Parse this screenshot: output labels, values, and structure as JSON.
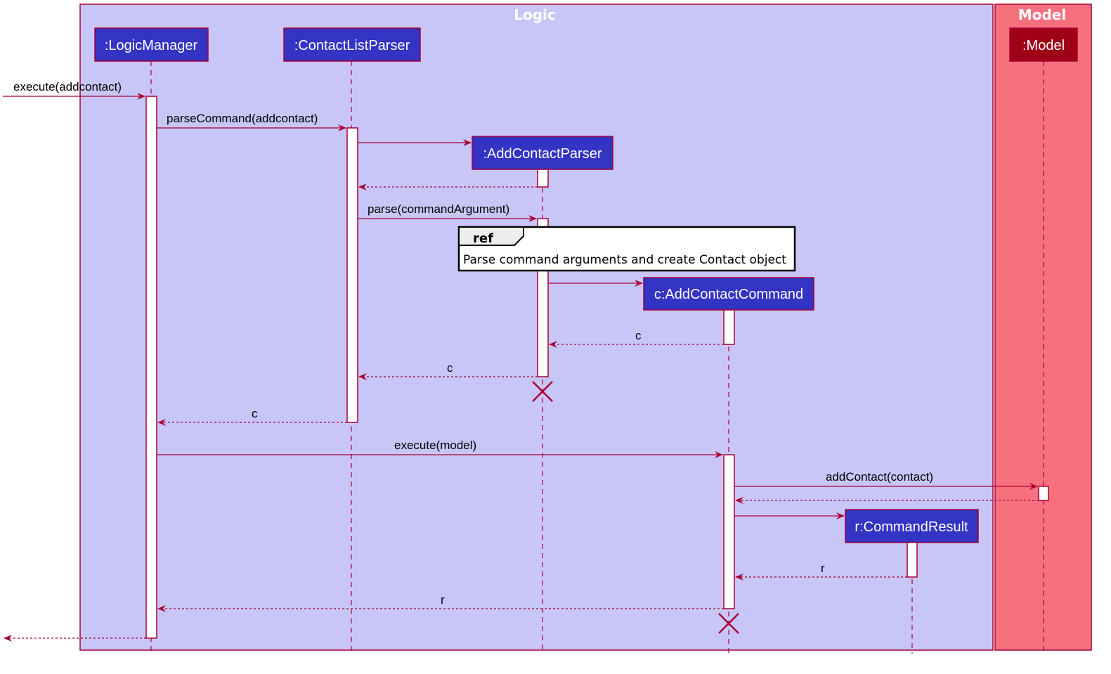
{
  "colors": {
    "logic_bg": "#C8C6F7",
    "model_bg": "#F7707E",
    "border": "#A80036",
    "participant_fill": "#3333C4",
    "model_participant_fill": "#A00016",
    "activation_fill": "#FFFFFF",
    "arrow": "#A80036",
    "ref_header": "#EEEEEE",
    "ref_border": "#000000"
  },
  "groups": [
    {
      "id": "logic",
      "title": "Logic"
    },
    {
      "id": "model",
      "title": "Model"
    }
  ],
  "participants": [
    {
      "id": "lm",
      "label": ":LogicManager",
      "group": "logic"
    },
    {
      "id": "clp",
      "label": ":ContactListParser",
      "group": "logic"
    },
    {
      "id": "acp",
      "label": ":AddContactParser",
      "group": "logic"
    },
    {
      "id": "acc",
      "label": "c:AddContactCommand",
      "group": "logic"
    },
    {
      "id": "cr",
      "label": "r:CommandResult",
      "group": "logic"
    },
    {
      "id": "model",
      "label": ":Model",
      "group": "model"
    }
  ],
  "messages": [
    {
      "from": "external",
      "to": "lm",
      "label": "execute(addcontact)",
      "type": "sync"
    },
    {
      "from": "lm",
      "to": "clp",
      "label": "parseCommand(addcontact)",
      "type": "sync"
    },
    {
      "from": "clp",
      "to": "acp",
      "label": "",
      "type": "create"
    },
    {
      "from": "acp",
      "to": "clp",
      "label": "",
      "type": "return"
    },
    {
      "from": "clp",
      "to": "acp",
      "label": "parse(commandArgument)",
      "type": "sync"
    },
    {
      "from": "acp",
      "to": "acc",
      "label": "",
      "type": "create"
    },
    {
      "from": "acc",
      "to": "acp",
      "label": "c",
      "type": "return"
    },
    {
      "from": "acp",
      "to": "clp",
      "label": "c",
      "type": "return"
    },
    {
      "from": "clp",
      "to": "lm",
      "label": "c",
      "type": "return"
    },
    {
      "from": "lm",
      "to": "acc",
      "label": "execute(model)",
      "type": "sync"
    },
    {
      "from": "acc",
      "to": "model",
      "label": "addContact(contact)",
      "type": "sync"
    },
    {
      "from": "model",
      "to": "acc",
      "label": "",
      "type": "return"
    },
    {
      "from": "acc",
      "to": "cr",
      "label": "",
      "type": "create"
    },
    {
      "from": "cr",
      "to": "acc",
      "label": "r",
      "type": "return"
    },
    {
      "from": "acc",
      "to": "lm",
      "label": "r",
      "type": "return"
    },
    {
      "from": "lm",
      "to": "external",
      "label": "",
      "type": "return"
    }
  ],
  "ref": {
    "tag": "ref",
    "text": "Parse command arguments and create Contact object"
  },
  "destroyed": [
    "acp",
    "acc"
  ]
}
